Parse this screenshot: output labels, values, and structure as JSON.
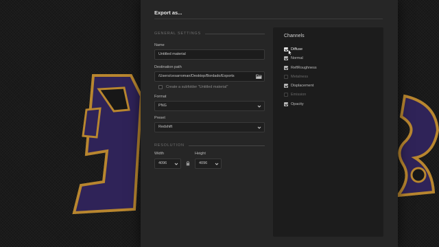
{
  "dialog": {
    "title": "Export as..."
  },
  "general": {
    "header": "GENERAL SETTINGS",
    "name_label": "Name",
    "name_value": "Untitled material",
    "dest_label": "Destination path",
    "dest_value": "/Users/cesarroman/Desktop/Bordado/Exports",
    "subfolder_label": "Create a subfolder \"Untitled material\"",
    "subfolder_checked": false,
    "format_label": "Format",
    "format_value": "PNG",
    "preset_label": "Preset",
    "preset_value": "Redshift"
  },
  "resolution": {
    "header": "RESOLUTION",
    "width_label": "Width",
    "width_value": "4096",
    "height_label": "Height",
    "height_value": "4096",
    "linked": true
  },
  "channels": {
    "title": "Channels",
    "items": [
      {
        "label": "Diffuse",
        "checked": true,
        "enabled": true
      },
      {
        "label": "Normal",
        "checked": true,
        "enabled": true
      },
      {
        "label": "ReflRoughness",
        "checked": true,
        "enabled": true
      },
      {
        "label": "Metalness",
        "checked": false,
        "enabled": false
      },
      {
        "label": "Displacement",
        "checked": true,
        "enabled": true
      },
      {
        "label": "Emission",
        "checked": false,
        "enabled": false
      },
      {
        "label": "Opacity",
        "checked": true,
        "enabled": true
      }
    ]
  },
  "icons": {
    "folder": "folder-open-icon",
    "chevron": "chevron-down-icon",
    "lock": "lock-icon",
    "cursor": "mouse-pointer-icon"
  },
  "colors": {
    "dialog_bg": "#262626",
    "panel_bg": "#1c1c1c",
    "embroidery_purple": "#3a2a6e",
    "embroidery_gold": "#b8862f"
  }
}
